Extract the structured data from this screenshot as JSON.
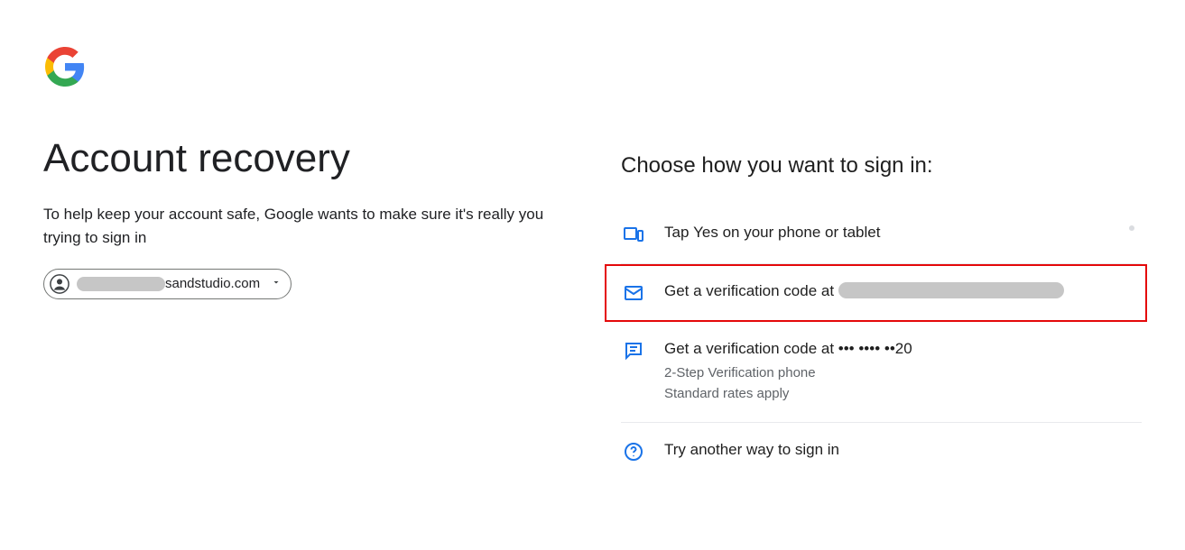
{
  "heading": "Account recovery",
  "subheading": "To help keep your account safe, Google wants to make sure it's really you trying to sign in",
  "account_chip": {
    "suffix": "sandstudio.com"
  },
  "choose_title": "Choose how you want to sign in:",
  "options": {
    "tap_yes_prefix": "Tap ",
    "tap_yes_bold": "Yes",
    "tap_yes_suffix": " on your phone or tablet",
    "email_code_prefix": "Get a verification code at ",
    "sms_code": "Get a verification code at ••• •••• ••20",
    "sms_sub1": "2-Step Verification phone",
    "sms_sub2": "Standard rates apply",
    "try_another": "Try another way to sign in"
  }
}
